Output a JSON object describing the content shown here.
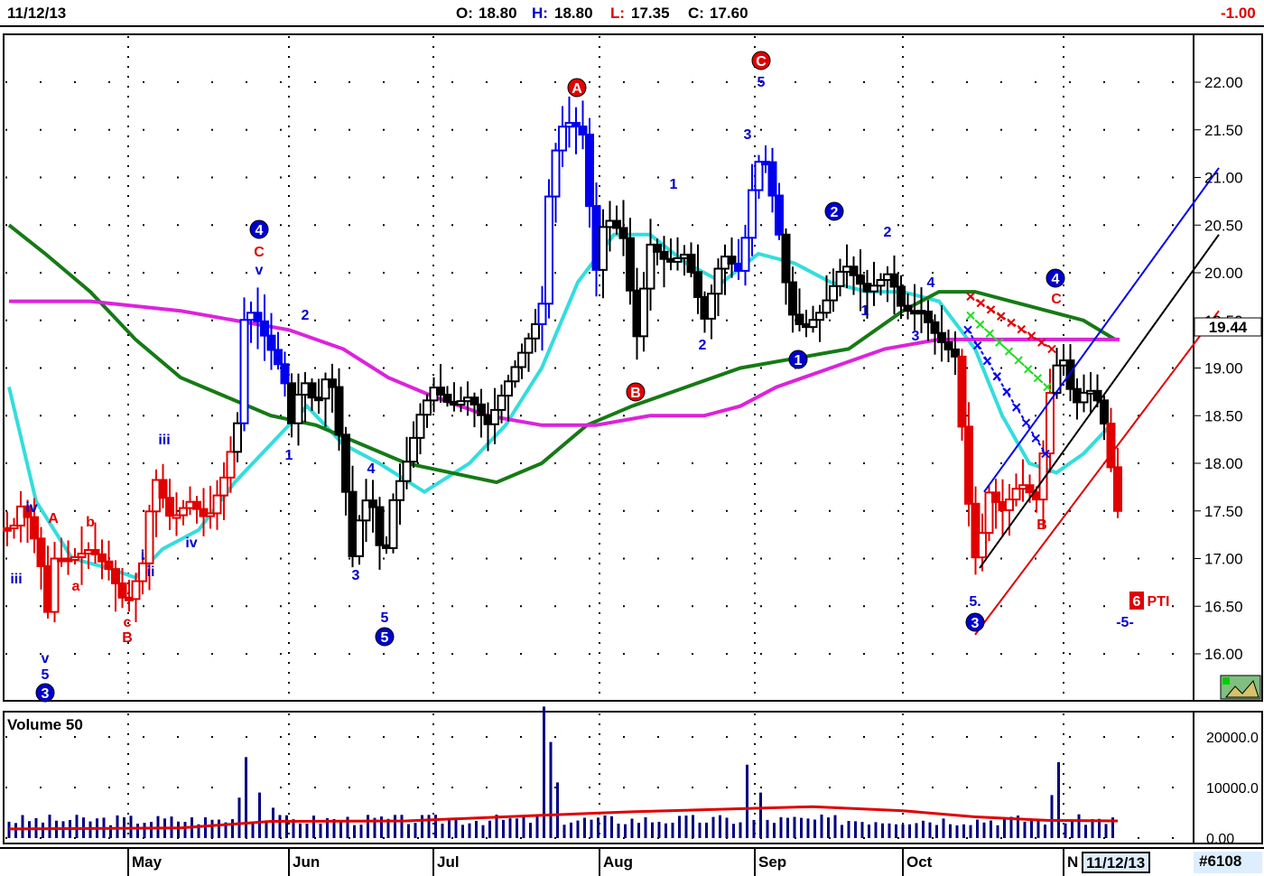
{
  "header": {
    "date": "11/12/13",
    "open_label": "O:",
    "open": "18.80",
    "high_label": "H:",
    "high": "18.80",
    "low_label": "L:",
    "low": "17.35",
    "close_label": "C:",
    "close": "17.60",
    "change": "-1.00"
  },
  "footer": {
    "months": [
      "May",
      "Jun",
      "Jul",
      "Aug",
      "Sep",
      "Oct",
      "N"
    ],
    "current_date": "11/12/13",
    "symbol_id": "#6108"
  },
  "colors": {
    "up_early": "#e00000",
    "down": "#000000",
    "blue_candles": "#0000ee",
    "cyan_ma": "#33dddd",
    "green_ma": "#157a15",
    "magenta_ma": "#dd22dd",
    "volume": "#000080",
    "volume_ma": "#e00000"
  },
  "chart_data": [
    {
      "type": "candlestick",
      "title": "",
      "ylim": [
        15.6,
        22.5
      ],
      "y_ticks": [
        "22.00",
        "21.50",
        "21.00",
        "20.50",
        "20.00",
        "19.50",
        "19.00",
        "18.50",
        "18.00",
        "17.50",
        "17.00",
        "16.50",
        "16.00"
      ],
      "last_price_tag": "19.44",
      "x_labels": [
        "May",
        "Jun",
        "Jul",
        "Aug",
        "Sep",
        "Oct",
        "N"
      ],
      "grid": true,
      "series": [
        {
          "name": "price",
          "kind": "ohlc_trace",
          "points": [
            [
              0,
              17.8
            ],
            [
              10,
              17.2
            ],
            [
              25,
              17.6
            ],
            [
              45,
              17.0
            ],
            [
              50,
              16.2
            ],
            [
              60,
              17.0
            ],
            [
              80,
              17.0
            ],
            [
              100,
              17.1
            ],
            [
              120,
              16.9
            ],
            [
              140,
              16.5
            ],
            [
              160,
              17.0
            ],
            [
              170,
              17.9
            ],
            [
              190,
              17.4
            ],
            [
              210,
              17.6
            ],
            [
              230,
              17.4
            ],
            [
              250,
              17.9
            ],
            [
              265,
              18.5
            ],
            [
              270,
              19.5
            ],
            [
              280,
              19.6
            ],
            [
              300,
              19.2
            ],
            [
              315,
              18.9
            ],
            [
              320,
              18.3
            ],
            [
              335,
              18.9
            ],
            [
              350,
              18.6
            ],
            [
              365,
              19.0
            ],
            [
              380,
              18.0
            ],
            [
              390,
              17.0
            ],
            [
              400,
              17.5
            ],
            [
              410,
              17.7
            ],
            [
              425,
              16.9
            ],
            [
              435,
              17.6
            ],
            [
              450,
              18.0
            ],
            [
              465,
              18.5
            ],
            [
              480,
              18.8
            ],
            [
              500,
              18.6
            ],
            [
              520,
              18.7
            ],
            [
              540,
              18.4
            ],
            [
              560,
              18.8
            ],
            [
              580,
              19.2
            ],
            [
              600,
              19.6
            ],
            [
              610,
              21.1
            ],
            [
              625,
              21.6
            ],
            [
              645,
              21.5
            ],
            [
              660,
              20.0
            ],
            [
              670,
              20.6
            ],
            [
              690,
              20.4
            ],
            [
              705,
              19.3
            ],
            [
              720,
              20.3
            ],
            [
              740,
              20.1
            ],
            [
              760,
              20.2
            ],
            [
              780,
              19.5
            ],
            [
              800,
              20.2
            ],
            [
              820,
              20.0
            ],
            [
              835,
              21.0
            ],
            [
              845,
              21.3
            ],
            [
              860,
              20.6
            ],
            [
              875,
              19.6
            ],
            [
              890,
              19.4
            ],
            [
              910,
              19.6
            ],
            [
              935,
              20.1
            ],
            [
              960,
              19.8
            ],
            [
              985,
              20.0
            ],
            [
              1000,
              19.6
            ],
            [
              1020,
              19.6
            ],
            [
              1040,
              19.3
            ],
            [
              1060,
              19.1
            ],
            [
              1070,
              17.8
            ],
            [
              1082,
              16.9
            ],
            [
              1095,
              17.7
            ],
            [
              1110,
              17.5
            ],
            [
              1130,
              17.8
            ],
            [
              1150,
              17.6
            ],
            [
              1162,
              18.7
            ],
            [
              1175,
              19.2
            ],
            [
              1190,
              18.6
            ],
            [
              1205,
              18.8
            ],
            [
              1220,
              18.6
            ],
            [
              1238,
              17.5
            ]
          ]
        },
        {
          "name": "cyan_ma",
          "kind": "ma",
          "points": [
            [
              10,
              18.8
            ],
            [
              40,
              17.6
            ],
            [
              80,
              17.0
            ],
            [
              120,
              16.9
            ],
            [
              150,
              16.8
            ],
            [
              180,
              17.1
            ],
            [
              220,
              17.3
            ],
            [
              260,
              17.8
            ],
            [
              300,
              18.2
            ],
            [
              340,
              18.6
            ],
            [
              380,
              18.2
            ],
            [
              420,
              18.0
            ],
            [
              470,
              17.7
            ],
            [
              520,
              18.0
            ],
            [
              560,
              18.4
            ],
            [
              600,
              19.0
            ],
            [
              640,
              19.9
            ],
            [
              680,
              20.4
            ],
            [
              720,
              20.4
            ],
            [
              760,
              20.1
            ],
            [
              800,
              19.9
            ],
            [
              840,
              20.2
            ],
            [
              880,
              20.1
            ],
            [
              920,
              19.9
            ],
            [
              960,
              19.8
            ],
            [
              1000,
              19.8
            ],
            [
              1040,
              19.7
            ],
            [
              1080,
              19.2
            ],
            [
              1110,
              18.5
            ],
            [
              1140,
              18.0
            ],
            [
              1170,
              17.9
            ],
            [
              1200,
              18.1
            ],
            [
              1230,
              18.4
            ]
          ]
        },
        {
          "name": "green_ma",
          "kind": "ma",
          "points": [
            [
              10,
              20.5
            ],
            [
              50,
              20.2
            ],
            [
              100,
              19.8
            ],
            [
              150,
              19.3
            ],
            [
              200,
              18.9
            ],
            [
              250,
              18.7
            ],
            [
              300,
              18.5
            ],
            [
              350,
              18.4
            ],
            [
              400,
              18.2
            ],
            [
              450,
              18.0
            ],
            [
              500,
              17.9
            ],
            [
              550,
              17.8
            ],
            [
              600,
              18.0
            ],
            [
              650,
              18.4
            ],
            [
              700,
              18.6
            ],
            [
              760,
              18.8
            ],
            [
              820,
              19.0
            ],
            [
              880,
              19.1
            ],
            [
              940,
              19.2
            ],
            [
              1000,
              19.6
            ],
            [
              1040,
              19.8
            ],
            [
              1080,
              19.8
            ],
            [
              1120,
              19.7
            ],
            [
              1160,
              19.6
            ],
            [
              1200,
              19.5
            ],
            [
              1235,
              19.3
            ]
          ]
        },
        {
          "name": "magenta_ma",
          "kind": "ma",
          "points": [
            [
              10,
              19.7
            ],
            [
              100,
              19.7
            ],
            [
              200,
              19.6
            ],
            [
              260,
              19.5
            ],
            [
              320,
              19.4
            ],
            [
              380,
              19.2
            ],
            [
              430,
              18.9
            ],
            [
              480,
              18.7
            ],
            [
              540,
              18.5
            ],
            [
              600,
              18.4
            ],
            [
              660,
              18.4
            ],
            [
              720,
              18.5
            ],
            [
              780,
              18.5
            ],
            [
              820,
              18.6
            ],
            [
              860,
              18.8
            ],
            [
              920,
              19.0
            ],
            [
              980,
              19.2
            ],
            [
              1040,
              19.3
            ],
            [
              1100,
              19.3
            ],
            [
              1160,
              19.3
            ],
            [
              1200,
              19.3
            ],
            [
              1240,
              19.3
            ]
          ]
        }
      ],
      "annotations": [
        "3",
        "v",
        "5",
        "iii",
        "iv",
        "A",
        "a",
        "b",
        "c",
        "B",
        "i",
        "ii",
        "iii",
        "iv",
        "4",
        "C",
        "v",
        "1",
        "2",
        "3",
        "4",
        "5",
        "5",
        "A",
        "B",
        "1",
        "2",
        "3",
        "C",
        "5",
        "1",
        "2",
        "2",
        "1",
        "3",
        "4",
        "5.",
        "3",
        "4",
        "C",
        "B",
        "6",
        "PTI",
        "-5-"
      ]
    },
    {
      "type": "bar",
      "title": "Volume 50",
      "ylim": [
        0,
        26000
      ],
      "y_ticks": [
        "20000.0",
        "10000.0",
        "0.00"
      ],
      "note": "volume bars with moving average line"
    }
  ]
}
